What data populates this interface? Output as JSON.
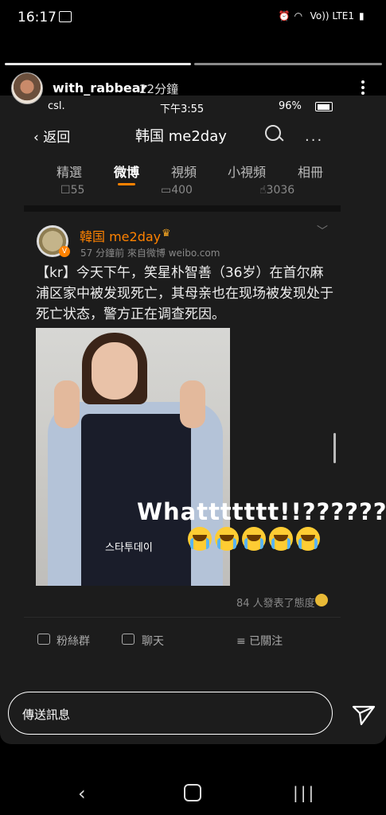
{
  "status_bar": {
    "time": "16:17",
    "right_text": "Vo)) LTE1"
  },
  "story": {
    "username": "with_rabbear",
    "posted_ago": "22分鐘"
  },
  "inner_status": {
    "carrier": "csl.",
    "time": "下午3:55",
    "battery": "96%"
  },
  "weibo_nav": {
    "back_label": "返回",
    "title": "韩国 me2day",
    "more": "···"
  },
  "tabs": [
    "精選",
    "微博",
    "視頻",
    "小視頻",
    "相冊"
  ],
  "active_tab": "微博",
  "prev_stats": {
    "reposts": "55",
    "comments": "400",
    "likes": "3036"
  },
  "post": {
    "author": "韓国 me2day",
    "meta": "57 分鐘前  來自微博 weibo.com",
    "text": "【kr】今天下午，笑星朴智善（36岁）在首尔麻浦区家中被发现死亡，其母亲也在现场被发现处于死亡状态，警方正在调查死因。",
    "watermark": "스타투데이",
    "attitude": "84 人發表了態度"
  },
  "overlay": {
    "text": "Whattttttt!!??????"
  },
  "footer": {
    "fans": "粉絲群",
    "chat": "聊天",
    "followed": "≡ 已關注"
  },
  "message": {
    "placeholder": "傳送訊息"
  },
  "colors": {
    "accent": "#ff8200",
    "panel_bg": "#1c1c1c"
  }
}
